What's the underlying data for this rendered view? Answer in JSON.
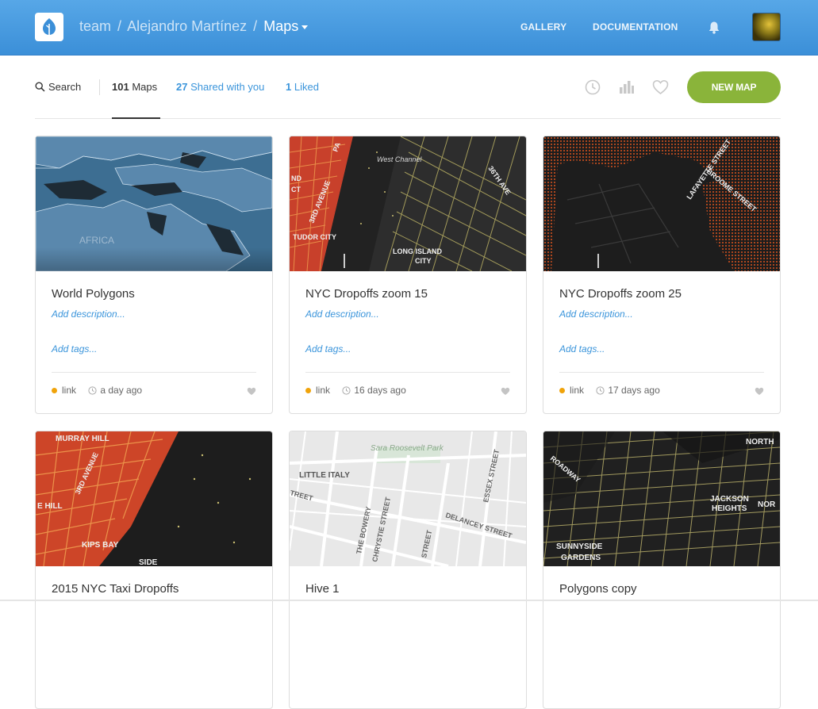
{
  "header": {
    "crumb_team": "team",
    "crumb_sep1": "/",
    "crumb_user": "Alejandro Martínez",
    "crumb_sep2": "/",
    "crumb_current": "Maps",
    "nav_gallery": "GALLERY",
    "nav_documentation": "DOCUMENTATION",
    "icons": [
      "carto-logo-icon",
      "bell-icon",
      "avatar"
    ],
    "brand_color": "#3b8fd8"
  },
  "toolbar": {
    "search_label": "Search",
    "maps_count": "101",
    "maps_label": " Maps",
    "shared_count": "27",
    "shared_label": " Shared with you",
    "liked_count": "1",
    "liked_label": " Liked",
    "new_map_label": "NEW MAP",
    "icons": [
      "clock-icon",
      "bar-chart-icon",
      "heart-icon"
    ],
    "accent_color": "#8ab43a"
  },
  "cards": [
    {
      "title": "World Polygons",
      "desc": "Add description...",
      "tags": "Add tags...",
      "privacy": "link",
      "updated": "a day ago"
    },
    {
      "title": "NYC Dropoffs zoom 15",
      "desc": "Add description...",
      "tags": "Add tags...",
      "privacy": "link",
      "updated": "16 days ago"
    },
    {
      "title": "NYC Dropoffs zoom 25",
      "desc": "Add description...",
      "tags": "Add tags...",
      "privacy": "link",
      "updated": "17 days ago"
    },
    {
      "title": "2015 NYC Taxi Dropoffs"
    },
    {
      "title": "Hive 1"
    },
    {
      "title": "Polygons copy"
    }
  ],
  "map_labels": {
    "m0": [
      "AFRICA"
    ],
    "m1": [
      "West Channel",
      "36TH AVE",
      "3RD AVENUE",
      "TUDOR CITY",
      "LONG ISLAND",
      "CITY",
      "ND",
      "CT",
      "PA"
    ],
    "m2": [
      "LAFAYETTE STREET",
      "BROOME STREET"
    ],
    "m3": [
      "MURRAY HILL",
      "3RD AVENUE",
      "E HILL",
      "KIPS BAY",
      "SIDE"
    ],
    "m4": [
      "Sara Roosevelt Park",
      "LITTLE ITALY",
      "THE BOWERY",
      "CHRYSTIE STREET",
      "DELANCEY STREET",
      "ESSEX STREET",
      "STREET",
      "TREET"
    ],
    "m5": [
      "ROADWAY",
      "NORTH",
      "JACKSON",
      "HEIGHTS",
      "NOR",
      "SUNNYSIDE",
      "GARDENS"
    ]
  }
}
